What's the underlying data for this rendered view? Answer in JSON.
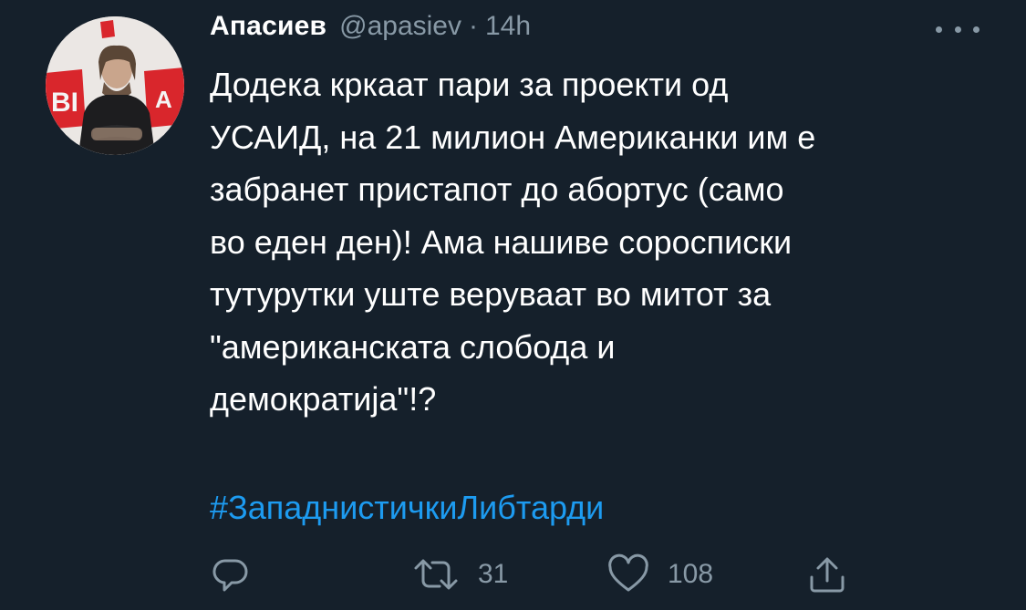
{
  "tweet": {
    "author": {
      "display_name": "Апасиев",
      "handle": "@apasiev",
      "time_separator": "·",
      "time": "14h"
    },
    "text": "Додека кркаат пари за проекти од\nУСАИД, на 21 милион Американки им е\nзабранет пристапот до абортус (само\nво еден ден)! Ама нашиве сороспи­ски\nтутурутки уште веруваат во митот за\n\"американската слобода и\nдемократија\"!?",
    "hashtag": "#ЗападнистичкиЛибтарди",
    "actions": {
      "reply_icon": "reply-icon",
      "retweet_icon": "retweet-icon",
      "retweet_count": "31",
      "like_icon": "heart-icon",
      "like_count": "108",
      "share_icon": "share-icon"
    }
  },
  "colors": {
    "background": "#15202b",
    "text": "#ffffff",
    "secondary": "#8899a6",
    "link": "#1d9bf0"
  }
}
